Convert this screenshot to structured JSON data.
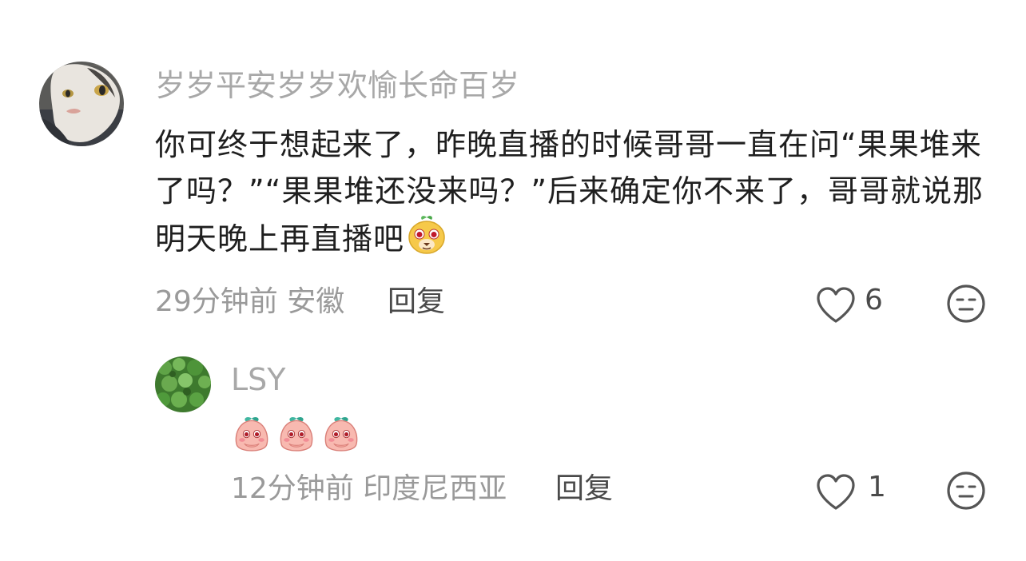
{
  "comment": {
    "username": "岁岁平安岁岁欢愉长命百岁",
    "text": "你可终于想起来了，昨晚直播的时候哥哥一直在问“果果堆来了吗？”“果果堆还没来吗？”后来确定你不来了，哥哥就说那明天晚上再直播吧",
    "emoji_icon": "yellow-mascot-emoji-icon",
    "time": "29分钟前",
    "location": "安徽",
    "reply_label": "回复",
    "like_count": "6"
  },
  "reply": {
    "username": "LSY",
    "stickers": [
      "peach-shy-sticker-icon",
      "peach-shy-sticker-icon",
      "peach-shy-sticker-icon"
    ],
    "time": "12分钟前",
    "location": "印度尼西亚",
    "reply_label": "回复",
    "like_count": "1"
  }
}
